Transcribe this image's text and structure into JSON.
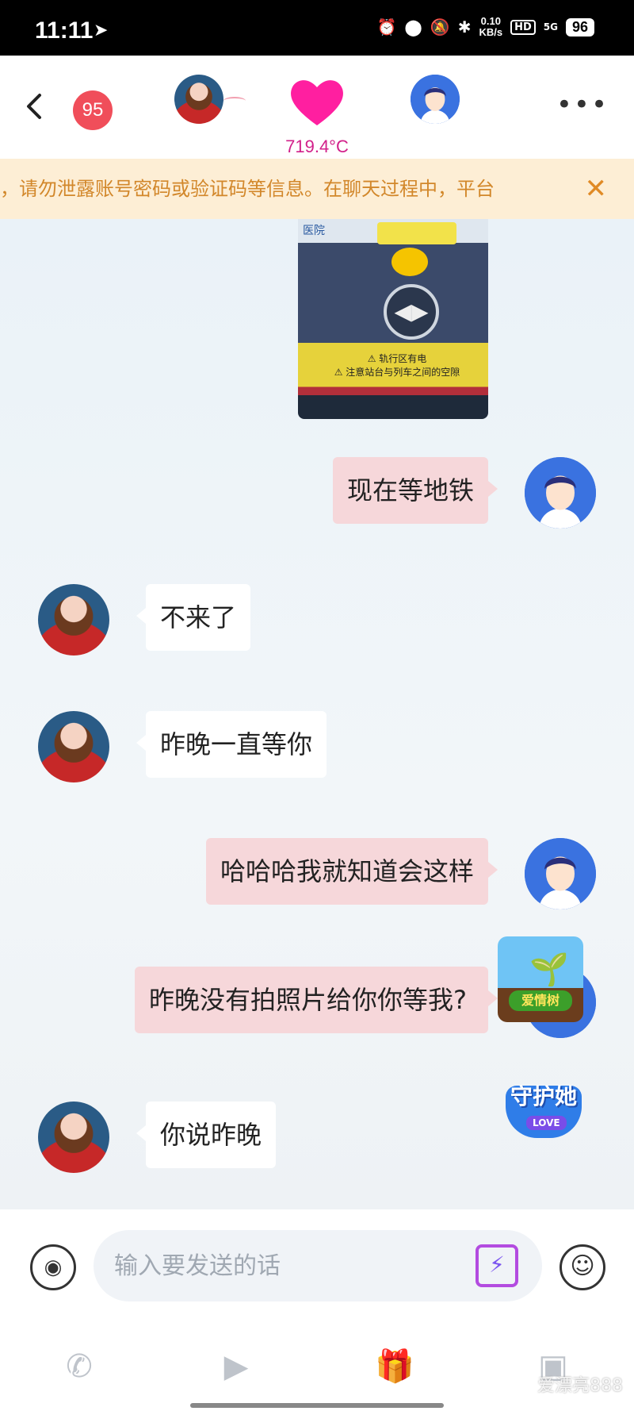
{
  "status_bar": {
    "time": "11:11",
    "net_speed_value": "0.10",
    "net_speed_unit": "KB/s",
    "hd_label": "HD",
    "signal_label": "5G",
    "battery": "96"
  },
  "header": {
    "unread_count": "95",
    "intimacy_temp": "719.4°C"
  },
  "notice": {
    "text": "，请勿泄露账号密码或验证码等信息。在聊天过程中，平台"
  },
  "photo_message": {
    "top_label": "医院",
    "warning_line1": "⚠ 轨行区有电",
    "warning_line2": "⚠ 注意站台与列车之间的空隙"
  },
  "messages": [
    {
      "sender": "me",
      "text": "现在等地铁"
    },
    {
      "sender": "her",
      "text": "不来了"
    },
    {
      "sender": "her",
      "text": "昨晚一直等你"
    },
    {
      "sender": "me",
      "text": "哈哈哈我就知道会这样"
    },
    {
      "sender": "me",
      "text": "昨晚没有拍照片给你你等我?"
    },
    {
      "sender": "her",
      "text": "你说昨晚"
    }
  ],
  "floating": {
    "love_tree_label": "爱情树",
    "guard_title": "守护她",
    "guard_love": "LOVE"
  },
  "input": {
    "placeholder": "输入要发送的话"
  },
  "watermark": "爱漂亮888",
  "colors": {
    "accent_pink": "#ff1fa0",
    "my_bubble": "#f6d7da",
    "her_bubble": "#ffffff",
    "notice_bg": "#fdeed5",
    "notice_text": "#d2872a",
    "badge_red": "#f04e5a"
  },
  "icons": [
    "back-arrow-icon",
    "heart-icon",
    "more-icon",
    "close-icon",
    "voice-icon",
    "magic-icon",
    "emoji-icon",
    "phone-icon",
    "video-icon",
    "gift-icon",
    "image-icon"
  ]
}
